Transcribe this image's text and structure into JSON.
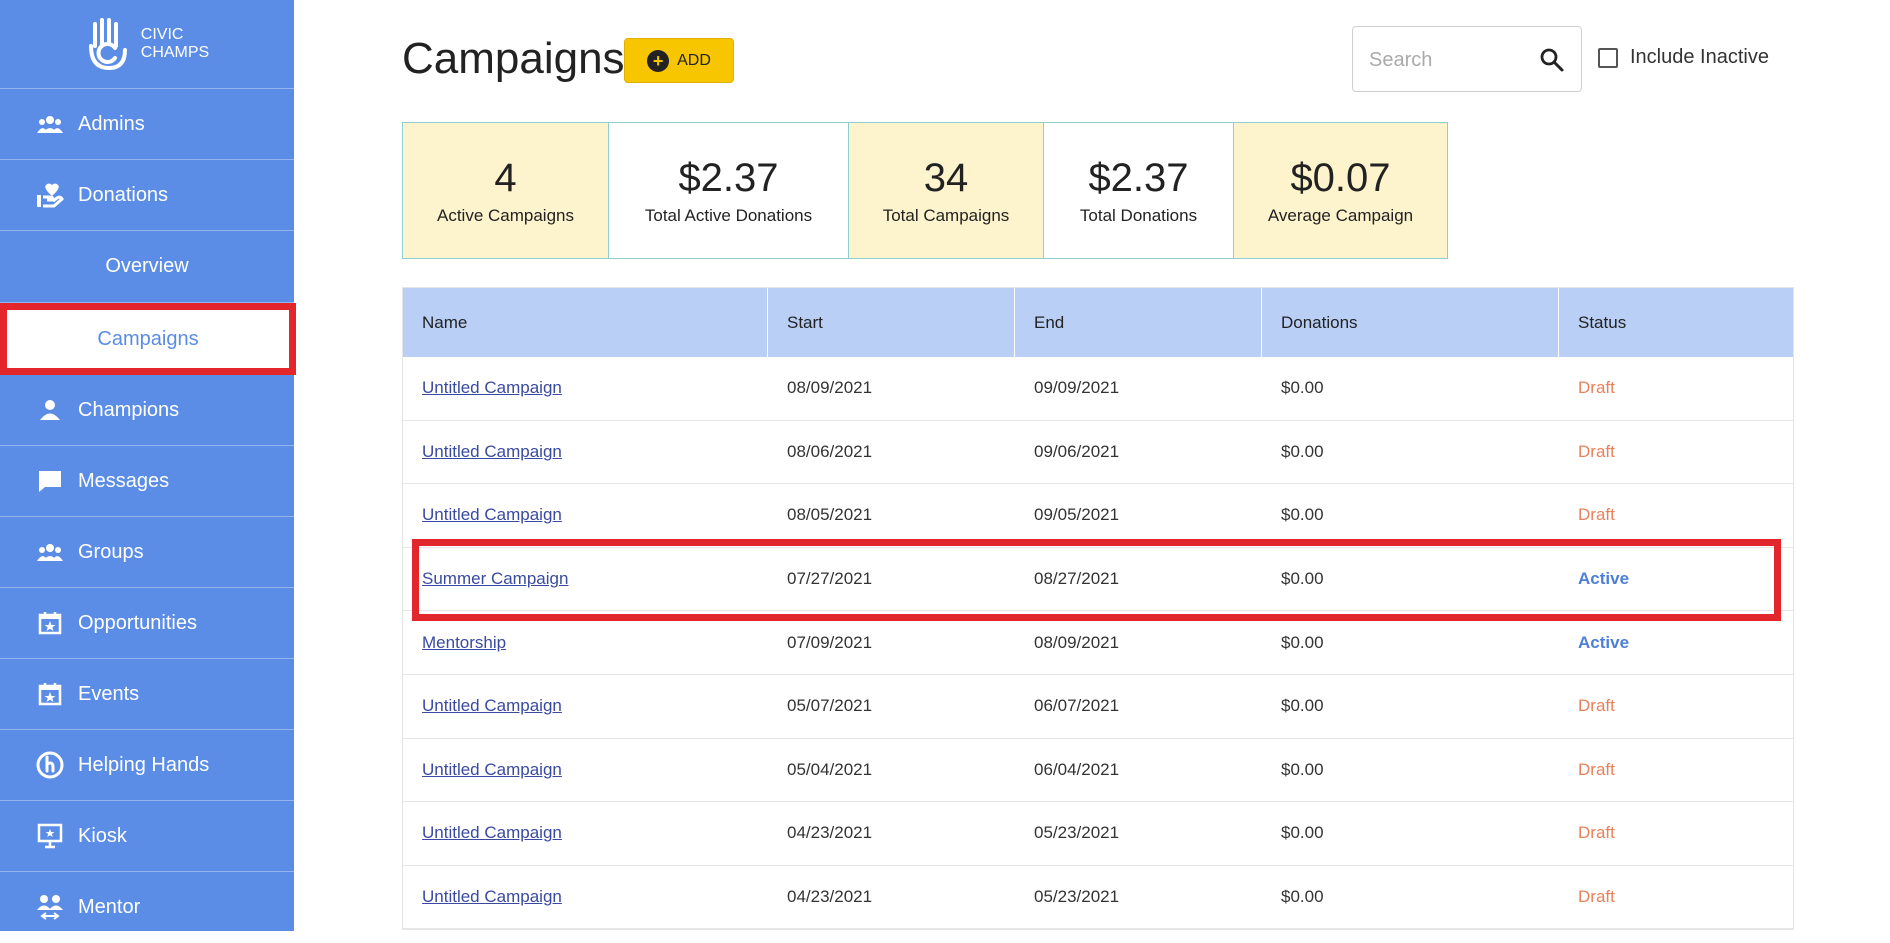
{
  "brand": {
    "line1": "CIVIC",
    "line2": "CHAMPS"
  },
  "colors": {
    "sidebar": "#5b8de6",
    "accent": "#f7c600",
    "highlight": "#e3262b",
    "draft": "#e9815a",
    "active": "#4e7fd6"
  },
  "sidebar": {
    "items": [
      {
        "label": "Admins",
        "icon": "people-icon"
      },
      {
        "label": "Donations",
        "icon": "hand-heart-icon"
      },
      {
        "label": "Overview"
      },
      {
        "label": "Campaigns"
      },
      {
        "label": "Champions",
        "icon": "person-icon"
      },
      {
        "label": "Messages",
        "icon": "chat-icon"
      },
      {
        "label": "Groups",
        "icon": "group-icon"
      },
      {
        "label": "Opportunities",
        "icon": "calendar-star-icon"
      },
      {
        "label": "Events",
        "icon": "calendar-star-icon"
      },
      {
        "label": "Helping Hands",
        "icon": "helping-hands-icon"
      },
      {
        "label": "Kiosk",
        "icon": "kiosk-icon"
      },
      {
        "label": "Mentor",
        "icon": "mentor-icon"
      }
    ]
  },
  "header": {
    "title": "Campaigns",
    "add_label": "ADD",
    "search_placeholder": "Search",
    "include_inactive": "Include Inactive"
  },
  "stats": [
    {
      "value": "4",
      "label": "Active Campaigns"
    },
    {
      "value": "$2.37",
      "label": "Total Active Donations"
    },
    {
      "value": "34",
      "label": "Total Campaigns"
    },
    {
      "value": "$2.37",
      "label": "Total Donations"
    },
    {
      "value": "$0.07",
      "label": "Average Campaign"
    }
  ],
  "table": {
    "columns": [
      "Name",
      "Start",
      "End",
      "Donations",
      "Status"
    ],
    "rows": [
      {
        "name": "Untitled Campaign",
        "start": "08/09/2021",
        "end": "09/09/2021",
        "donations": "$0.00",
        "status": "Draft"
      },
      {
        "name": "Untitled Campaign",
        "start": "08/06/2021",
        "end": "09/06/2021",
        "donations": "$0.00",
        "status": "Draft"
      },
      {
        "name": "Untitled Campaign",
        "start": "08/05/2021",
        "end": "09/05/2021",
        "donations": "$0.00",
        "status": "Draft"
      },
      {
        "name": "Summer Campaign",
        "start": "07/27/2021",
        "end": "08/27/2021",
        "donations": "$0.00",
        "status": "Active"
      },
      {
        "name": "Mentorship",
        "start": "07/09/2021",
        "end": "08/09/2021",
        "donations": "$0.00",
        "status": "Active"
      },
      {
        "name": "Untitled Campaign",
        "start": "05/07/2021",
        "end": "06/07/2021",
        "donations": "$0.00",
        "status": "Draft"
      },
      {
        "name": "Untitled Campaign",
        "start": "05/04/2021",
        "end": "06/04/2021",
        "donations": "$0.00",
        "status": "Draft"
      },
      {
        "name": "Untitled Campaign",
        "start": "04/23/2021",
        "end": "05/23/2021",
        "donations": "$0.00",
        "status": "Draft"
      },
      {
        "name": "Untitled Campaign",
        "start": "04/23/2021",
        "end": "05/23/2021",
        "donations": "$0.00",
        "status": "Draft"
      }
    ]
  }
}
